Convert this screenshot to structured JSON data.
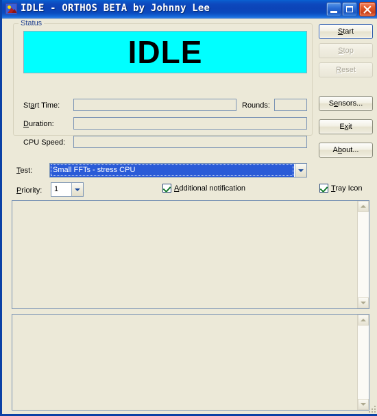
{
  "window": {
    "title": "IDLE - ORTHOS BETA by Johnny Lee",
    "icon": "picture-icon",
    "controls": {
      "minimize": "minimize-icon",
      "maximize": "maximize-icon",
      "close": "close-icon"
    },
    "accent_titlebar": "#0B49BE",
    "face_color": "#ECE9D8"
  },
  "status_group": {
    "legend": "Status",
    "display": {
      "text": "IDLE",
      "background": "#00FFFF",
      "foreground": "#000000"
    },
    "fields": [
      {
        "label": "Start Time:",
        "accel": "a",
        "value": ""
      },
      {
        "label": "Rounds:",
        "accel": "",
        "value": ""
      },
      {
        "label": "Duration:",
        "accel": "D",
        "value": ""
      },
      {
        "label": "CPU Speed:",
        "accel": "",
        "value": ""
      }
    ]
  },
  "labels": {
    "start_time": "Start Time:",
    "rounds": "Rounds:",
    "duration": "Duration:",
    "cpu_speed": "CPU Speed:",
    "test": "Test:",
    "priority": "Priority:"
  },
  "buttons": {
    "start": "Start",
    "stop": "Stop",
    "reset": "Reset",
    "sensors": "Sensors...",
    "exit": "Exit",
    "about": "About..."
  },
  "button_states": {
    "start": "default-focused",
    "stop": "disabled",
    "reset": "disabled",
    "sensors": "enabled",
    "exit": "enabled",
    "about": "enabled"
  },
  "test_combo": {
    "selected": "Small FFTs - stress CPU",
    "arrow": "chevron-down-icon",
    "focused": true
  },
  "priority_combo": {
    "selected": "1",
    "arrow": "chevron-down-icon"
  },
  "checkboxes": {
    "additional_notification": {
      "label": "Additional notification",
      "checked": true
    },
    "tray_icon": {
      "label": "Tray Icon",
      "checked": true
    }
  },
  "text_areas": {
    "top": {
      "value": "",
      "scrollbar": true
    },
    "bottom": {
      "value": "",
      "scrollbar": true
    }
  }
}
